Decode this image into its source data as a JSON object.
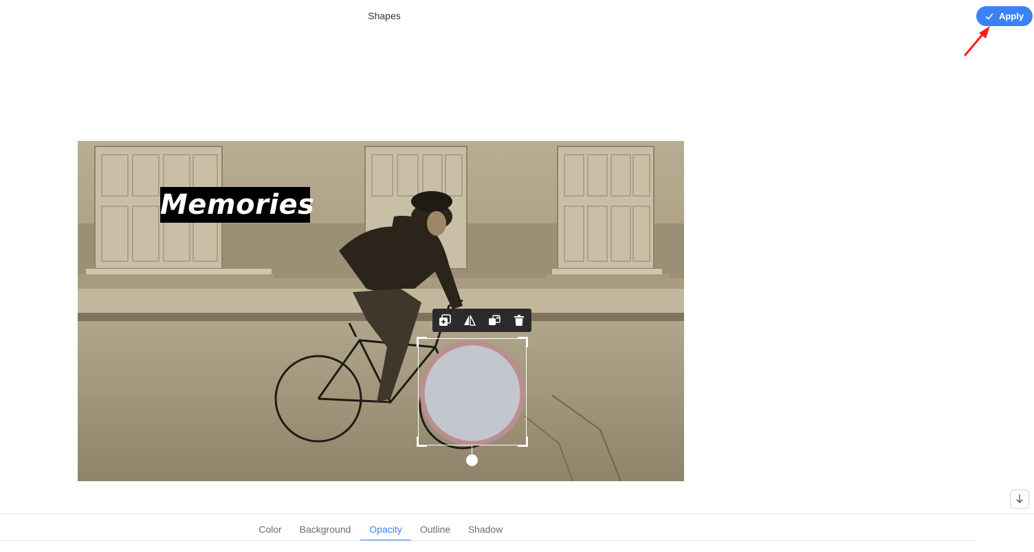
{
  "header": {
    "title": "Shapes"
  },
  "actions": {
    "apply_label": "Apply"
  },
  "canvas": {
    "overlay_text": "Memories"
  },
  "shape_toolbar": {
    "tools": [
      {
        "name": "duplicate-icon"
      },
      {
        "name": "flip-icon"
      },
      {
        "name": "bring-forward-icon"
      },
      {
        "name": "delete-icon"
      }
    ]
  },
  "bottom_tabs": {
    "active": "Opacity",
    "items": [
      {
        "label": "Color"
      },
      {
        "label": "Background"
      },
      {
        "label": "Opacity"
      },
      {
        "label": "Outline"
      },
      {
        "label": "Shadow"
      }
    ]
  },
  "colors": {
    "accent": "#3b82f6",
    "annotation_arrow": "#ff1a1a",
    "shape_fill": "#c3c6cc",
    "shape_outline": "#b98f91"
  }
}
